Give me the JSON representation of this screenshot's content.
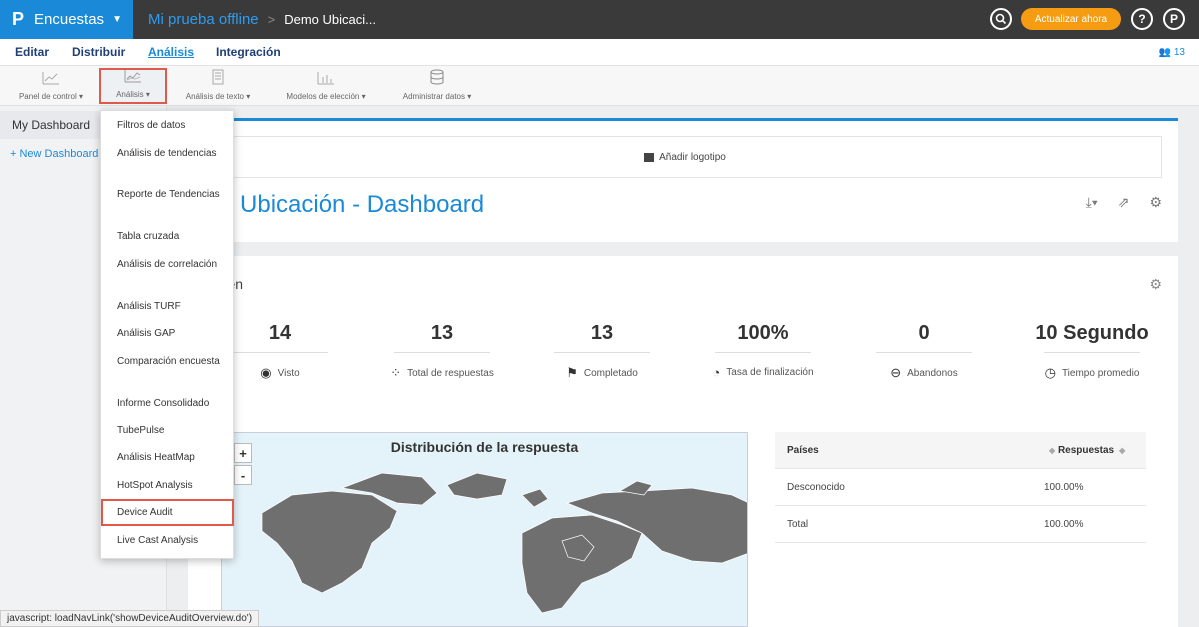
{
  "topbar": {
    "brand_logo": "P",
    "brand_name": "Encuestas",
    "breadcrumb_project": "Mi prueba offline",
    "breadcrumb_sep": ">",
    "breadcrumb_current": "Demo Ubicaci...",
    "upgrade_label": "Actualizar ahora",
    "help_label": "?",
    "profile_label": "P"
  },
  "nav": {
    "items": [
      "Editar",
      "Distribuir",
      "Análisis",
      "Integración"
    ],
    "users_count": "13"
  },
  "toolbar": {
    "tools": [
      {
        "label": "Panel de control ▾",
        "icon": "line-chart-icon"
      },
      {
        "label": "Análisis ▾",
        "icon": "analysis-chart-icon"
      },
      {
        "label": "Análisis de texto ▾",
        "icon": "text-analysis-icon"
      },
      {
        "label": "Modelos de elección ▾",
        "icon": "choice-model-icon"
      },
      {
        "label": "Administrar datos ▾",
        "icon": "database-icon"
      }
    ]
  },
  "sidebar": {
    "item": "My Dashboard",
    "new_dashboard": "+ New Dashboard"
  },
  "dashboard": {
    "add_logo": "Añadir logotipo",
    "title": "mo Ubicación - Dashboard",
    "resumen_title": "umen"
  },
  "metrics": [
    {
      "value": "14",
      "label": "Visto",
      "icon": "eye-icon"
    },
    {
      "value": "13",
      "label": "Total de respuestas",
      "icon": "dots-icon"
    },
    {
      "value": "13",
      "label": "Completado",
      "icon": "flag-icon"
    },
    {
      "value": "100%",
      "label": "Tasa de finalización",
      "icon": "pie-icon"
    },
    {
      "value": "0",
      "label": "Abandonos",
      "icon": "minus-circle-icon"
    },
    {
      "value": "10 Segundo",
      "label": "Tiempo promedio",
      "icon": "clock-icon"
    }
  ],
  "map": {
    "title": "Distribución de la respuesta",
    "zoom_in": "+",
    "zoom_out": "-"
  },
  "table": {
    "headers": [
      "Países",
      "Respuestas"
    ],
    "rows": [
      [
        "Desconocido",
        "100.00%"
      ],
      [
        "Total",
        "100.00%"
      ]
    ]
  },
  "dropdown": {
    "items": [
      "Filtros de datos",
      "Análisis de tendencias",
      "Reporte de Tendencias",
      "Tabla cruzada",
      "Análisis de correlación",
      "Análisis TURF",
      "Análisis GAP",
      "Comparación encuesta",
      "Informe Consolidado",
      "TubePulse",
      "Análisis HeatMap",
      "HotSpot Analysis",
      "Device Audit",
      "Live Cast Analysis"
    ]
  },
  "status_bar": "javascript: loadNavLink('showDeviceAuditOverview.do')",
  "colors": {
    "accent": "#1a8ad8",
    "upgrade": "#f59c12",
    "highlight": "#e05a4c",
    "topbar": "#3a3a3a"
  }
}
